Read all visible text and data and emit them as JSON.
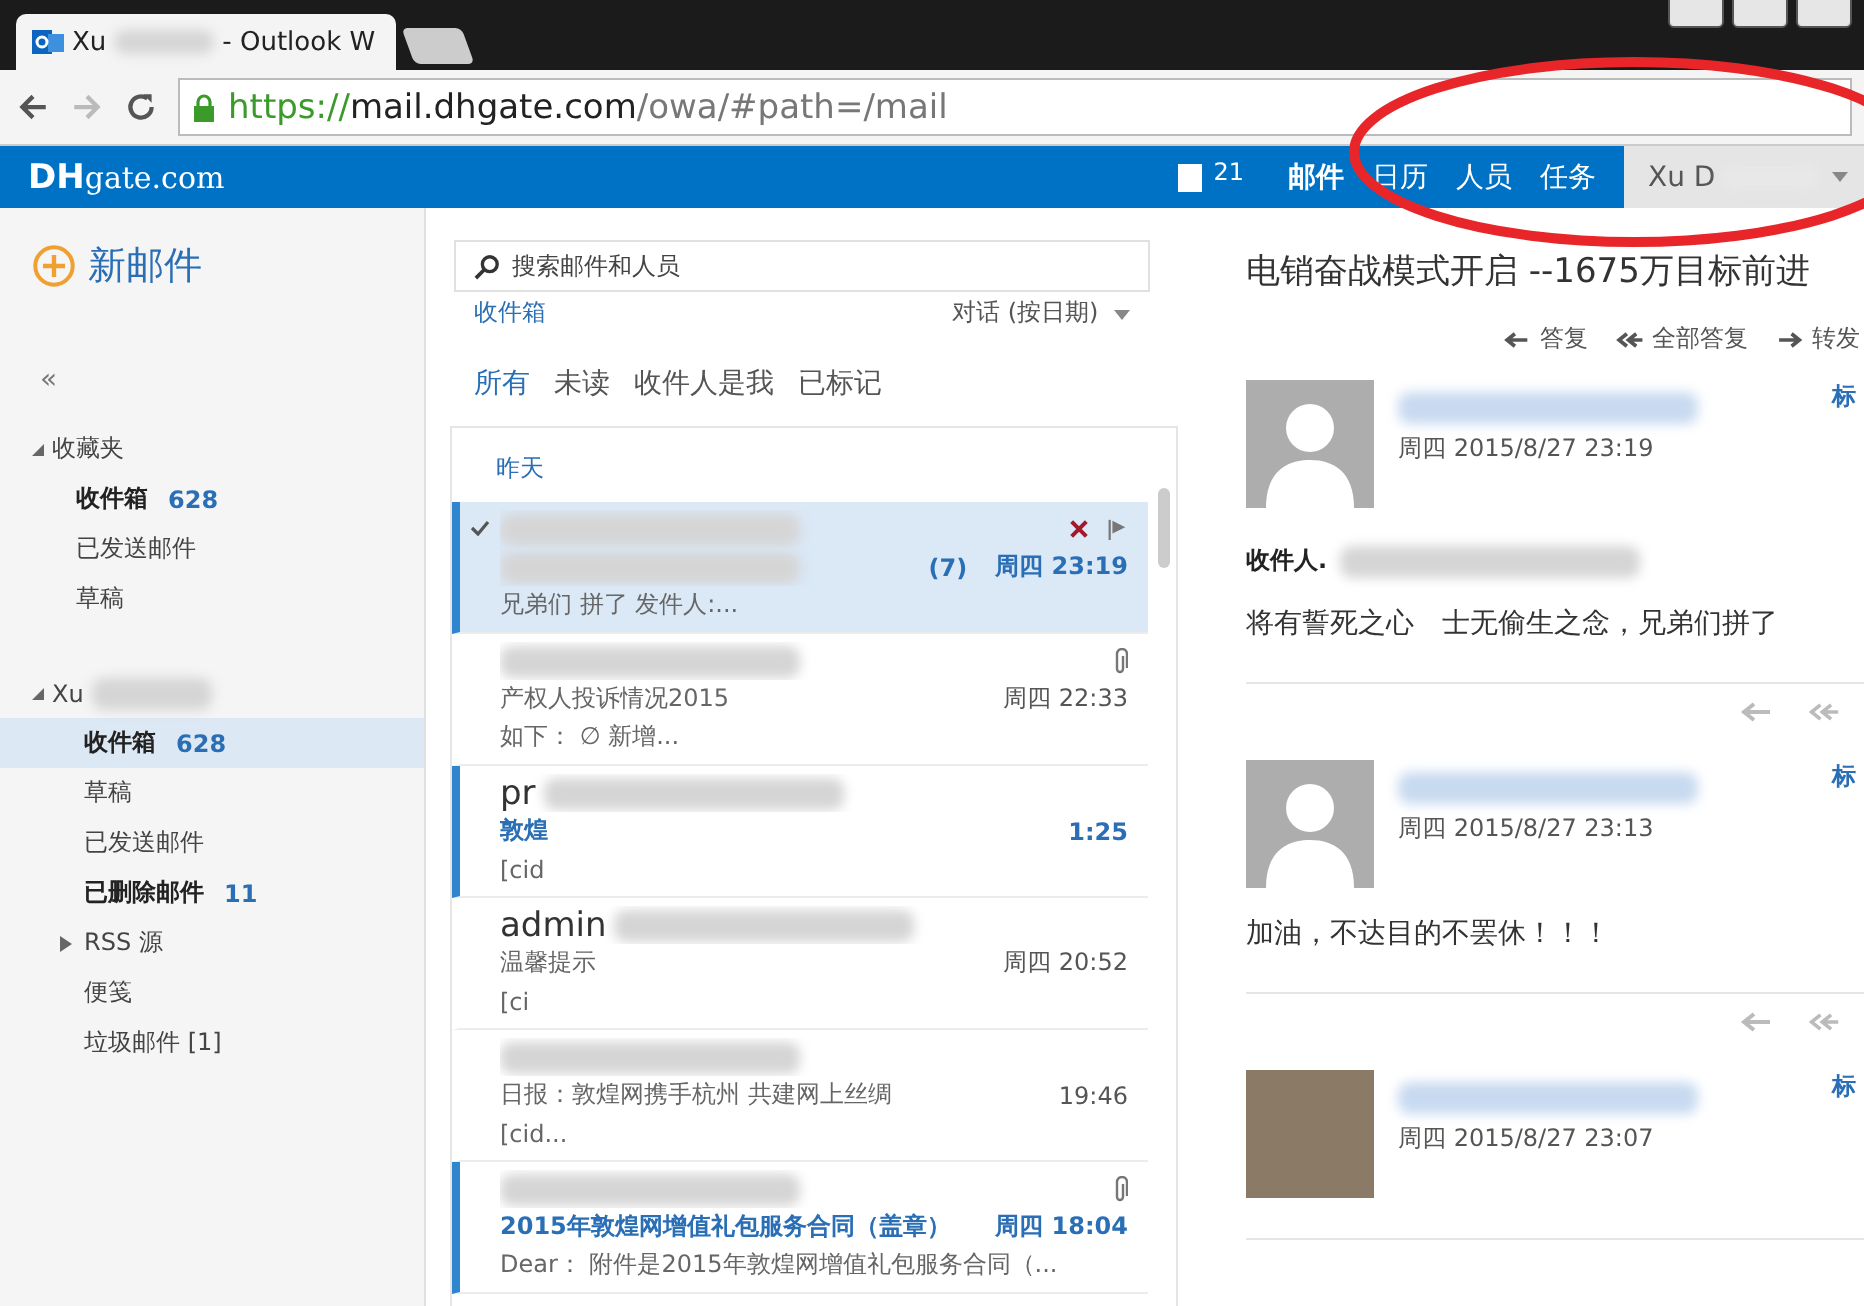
{
  "browser": {
    "tab_title_start": "Xu",
    "tab_title_end": "- Outlook W",
    "url": {
      "scheme": "https://",
      "host": "mail.dhgate.com",
      "path": "/owa/#path=/mail"
    }
  },
  "header": {
    "logo": "**DH**gate.com",
    "notification_count": "21",
    "nav": [
      {
        "label": "邮件",
        "selected": true
      },
      {
        "label": "日历",
        "selected": false
      },
      {
        "label": "人员",
        "selected": false
      },
      {
        "label": "任务",
        "selected": false
      }
    ],
    "user": "Xu D"
  },
  "highlight_circle": true,
  "sidebar": {
    "new_mail": "新邮件",
    "collapse": "«",
    "groups": [
      {
        "name": "收藏夹",
        "expanded": true,
        "folders": [
          {
            "name": "收件箱",
            "count": "628",
            "selected": false,
            "kind": "folder"
          },
          {
            "name": "已发送邮件",
            "selected": false,
            "kind": "folder"
          },
          {
            "name": "草稿",
            "selected": false,
            "kind": "folder"
          }
        ]
      },
      {
        "name": "Xu",
        "expanded": true,
        "folders": [
          {
            "name": "收件箱",
            "count": "628",
            "selected": true,
            "kind": "folder"
          },
          {
            "name": "草稿",
            "selected": false,
            "kind": "folder"
          },
          {
            "name": "已发送邮件",
            "selected": false,
            "kind": "folder"
          },
          {
            "name": "已删除邮件",
            "count": "11",
            "selected": false,
            "kind": "folder"
          },
          {
            "name": "RSS 源",
            "selected": false,
            "kind": "collapsible"
          },
          {
            "name": "便笺",
            "selected": false,
            "kind": "folder"
          },
          {
            "name": "垃圾邮件 [1]",
            "selected": false,
            "kind": "folder"
          }
        ]
      }
    ]
  },
  "list": {
    "search_placeholder": "搜索邮件和人员",
    "folder": "收件箱",
    "sort": "对话 (按日期)",
    "filters": [
      {
        "label": "所有",
        "selected": true
      },
      {
        "label": "未读",
        "selected": false
      },
      {
        "label": "收件人是我",
        "selected": false
      },
      {
        "label": "已标记",
        "selected": false
      }
    ],
    "date_group": "昨天",
    "items": [
      {
        "count": "(7)",
        "time": "周四 23:19",
        "preview": "兄弟们 拼了  发件人:...",
        "unread": true,
        "selected": true,
        "attachment": false
      },
      {
        "subject": "产权人投诉情况2015",
        "time": "周四 22:33",
        "preview": "如下：  ∅ 新增...",
        "unread": false,
        "selected": false,
        "attachment": true
      },
      {
        "sender": "pr",
        "subject": "敦煌",
        "time": "1:25",
        "preview": "[cid",
        "unread": true,
        "selected": false,
        "attachment": false
      },
      {
        "sender": "admin",
        "subject": "温馨提示",
        "time": "周四 20:52",
        "preview": "[ci",
        "unread": false,
        "selected": false,
        "attachment": false
      },
      {
        "subject": "日报：敦煌网携手杭州 共建网上丝绸",
        "time": "19:46",
        "preview": "[cid...",
        "unread": false,
        "selected": false,
        "attachment": false
      },
      {
        "subject": "2015年敦煌网增值礼包服务合同（盖章）",
        "time": "周四 18:04",
        "preview": "Dear：  附件是2015年敦煌网增值礼包服务合同（...",
        "unread": true,
        "selected": false,
        "attachment": true
      }
    ]
  },
  "reading": {
    "title": "电销奋战模式开启 --1675万目标前进",
    "actions": [
      "答复",
      "全部答复",
      "转发"
    ],
    "messages": [
      {
        "kind": "silhouette",
        "date": "周四 2015/8/27 23:19",
        "mark": "标",
        "recipient_label": "收件人.",
        "body": "将有誓死之心　士无偷生之念，兄弟们拼了",
        "show_actions": false
      },
      {
        "kind": "silhouette",
        "date": "周四 2015/8/27 23:13",
        "mark": "标",
        "body": "加油，不达目的不罢休！！！",
        "show_actions": true
      },
      {
        "kind": "photo",
        "date": "周四 2015/8/27 23:07",
        "mark": "标",
        "show_actions": true
      }
    ]
  }
}
